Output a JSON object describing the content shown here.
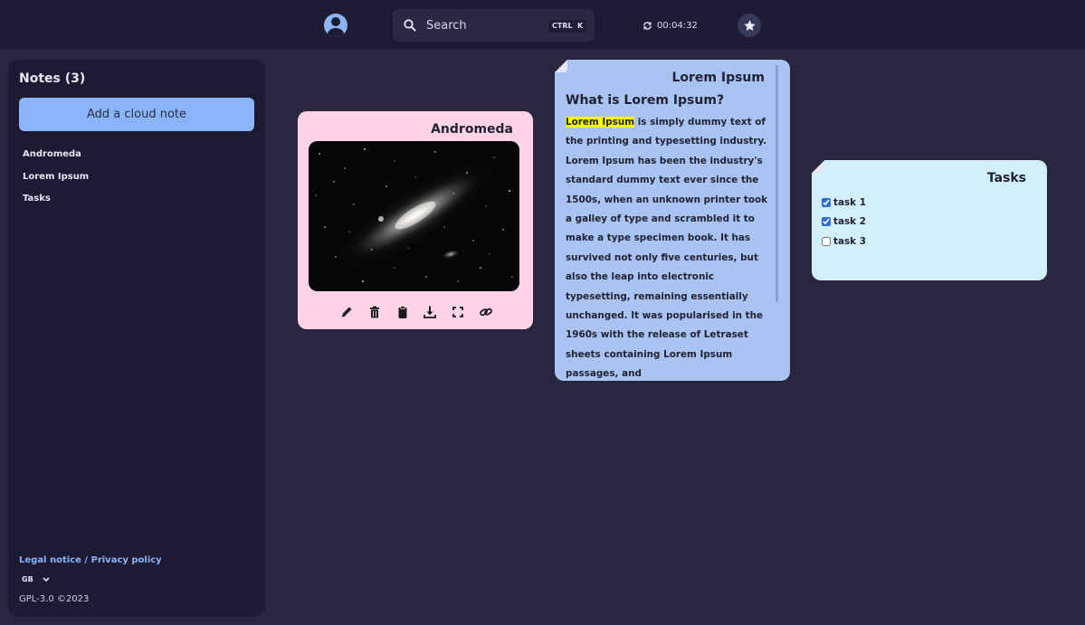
{
  "header": {
    "search_placeholder": "Search",
    "shortcut_ctrl": "CTRL",
    "shortcut_k": "K",
    "sync_time": "00:04:32",
    "icons": [
      "user-icon",
      "search-icon",
      "sync-icon",
      "star-icon"
    ]
  },
  "sidebar": {
    "title": "Notes (3)",
    "add_button_label": "Add a cloud note",
    "notes": [
      "Andromeda",
      "Lorem Ipsum",
      "Tasks"
    ],
    "legal_link": "Legal notice / Privacy policy",
    "language": "GB",
    "license": "GPL-3.0 ©2023"
  },
  "cards": {
    "andromeda": {
      "title": "Andromeda",
      "background": "#ffd3e6",
      "actions": [
        "edit-icon",
        "delete-icon",
        "clipboard-icon",
        "download-icon",
        "fullscreen-icon",
        "link-icon"
      ]
    },
    "lorem": {
      "title": "Lorem Ipsum",
      "background": "#a9c3f2",
      "heading": "What is Lorem Ipsum?",
      "highlight": "Lorem Ipsum",
      "body": " is simply dummy text of the printing and typesetting industry. Lorem Ipsum has been the industry's standard dummy text ever since the 1500s, when an unknown printer took a galley of type and scrambled it to make a type specimen book. It has survived not only five centuries, but also the leap into electronic typesetting, remaining essentially unchanged. It was popularised in the 1960s with the release of Letraset sheets containing Lorem Ipsum passages, and"
    },
    "tasks": {
      "title": "Tasks",
      "background": "#d2f0fb",
      "items": [
        {
          "label": "task 1",
          "checked": true
        },
        {
          "label": "task 2",
          "checked": true
        },
        {
          "label": "task 3",
          "checked": false
        }
      ]
    }
  },
  "colors": {
    "background": "#292640",
    "panel": "#1d1b33",
    "accent": "#8ab4f8",
    "highlight": "#ffff00"
  }
}
